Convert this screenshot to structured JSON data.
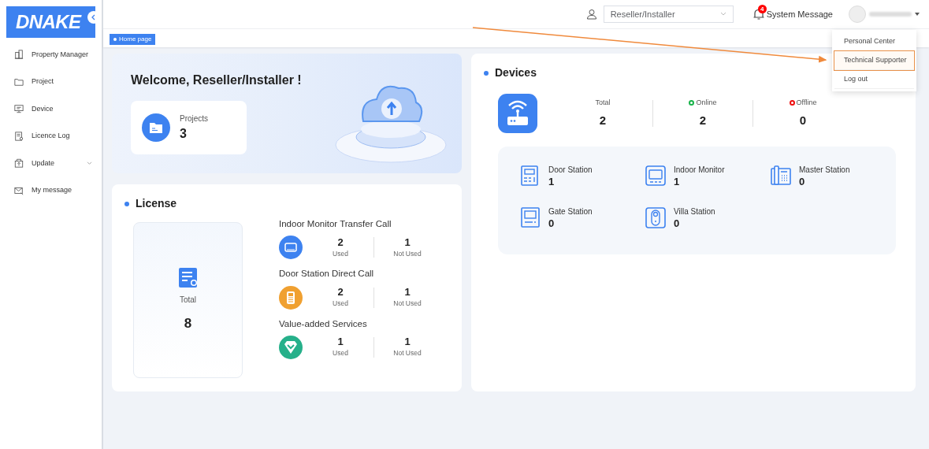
{
  "logo": "DNAKE",
  "sidebar": {
    "items": [
      {
        "label": "Property Manager",
        "kind": "building",
        "expandable": false
      },
      {
        "label": "Project",
        "kind": "folder",
        "expandable": false
      },
      {
        "label": "Device",
        "kind": "monitor",
        "expandable": false
      },
      {
        "label": "Licence Log",
        "kind": "license",
        "expandable": false
      },
      {
        "label": "Update",
        "kind": "update",
        "expandable": true
      },
      {
        "label": "My message",
        "kind": "mail",
        "expandable": false
      }
    ]
  },
  "header": {
    "role_select": {
      "value": "Reseller/Installer"
    },
    "system_message": {
      "label": "System Message",
      "badge": "4"
    }
  },
  "user_menu": {
    "items": [
      {
        "label": "Personal Center",
        "selected": false
      },
      {
        "label": "Technical Supporter",
        "selected": true
      },
      {
        "label": "Log out",
        "selected": false
      }
    ]
  },
  "tabs": [
    {
      "label": "Home page",
      "selected": true
    }
  ],
  "welcome": {
    "title": "Welcome, Reseller/Installer !",
    "projects": {
      "label": "Projects",
      "value": "3"
    }
  },
  "license": {
    "title": "License",
    "total": {
      "label": "Total",
      "value": "8"
    },
    "services": [
      {
        "name": "Indoor Monitor Transfer Call",
        "kind": "monitor",
        "used": "2",
        "used_label": "Used",
        "not_used": "1",
        "not_used_label": "Not Used"
      },
      {
        "name": "Door Station Direct Call",
        "kind": "door",
        "used": "2",
        "used_label": "Used",
        "not_used": "1",
        "not_used_label": "Not Used"
      },
      {
        "name": "Value-added Services",
        "kind": "value",
        "used": "1",
        "used_label": "Used",
        "not_used": "1",
        "not_used_label": "Not Used"
      }
    ]
  },
  "devices": {
    "title": "Devices",
    "summary": [
      {
        "label": "Total",
        "value": "2"
      },
      {
        "label": "Online",
        "value": "2",
        "color": "#19b34a"
      },
      {
        "label": "Offline",
        "value": "0",
        "color": "#ee1111"
      }
    ],
    "types": [
      {
        "name": "Door Station",
        "value": "1",
        "kind": "door"
      },
      {
        "name": "Indoor Monitor",
        "value": "1",
        "kind": "monitor"
      },
      {
        "name": "Master Station",
        "value": "0",
        "kind": "master"
      },
      {
        "name": "Gate Station",
        "value": "0",
        "kind": "gate"
      },
      {
        "name": "Villa Station",
        "value": "0",
        "kind": "villa"
      }
    ]
  }
}
